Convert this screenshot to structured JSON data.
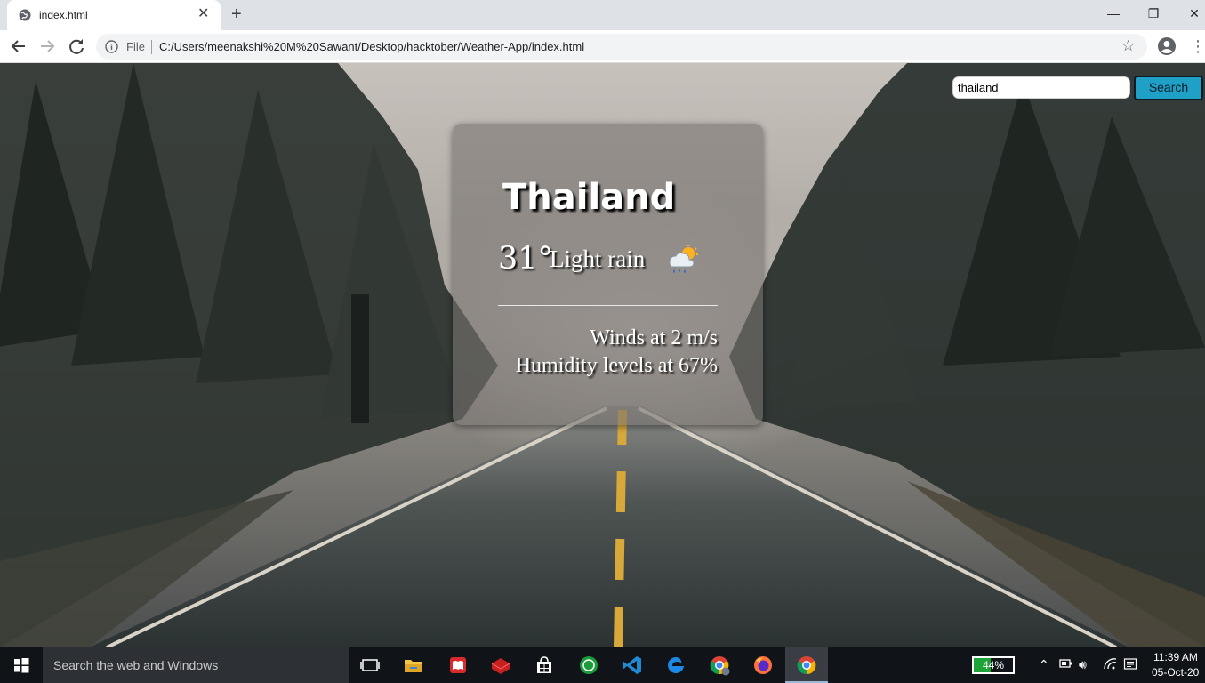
{
  "browser": {
    "tab_title": "index.html",
    "tab_close_glyph": "✕",
    "new_tab_glyph": "+",
    "window_controls": {
      "minimize": "—",
      "restore": "❐",
      "close": "✕"
    },
    "address_scheme_label": "File",
    "address_url": "C:/Users/meenakshi%20M%20Sawant/Desktop/hacktober/Weather-App/index.html",
    "icons": [
      "back-icon",
      "forward-icon",
      "reload-icon",
      "info-icon",
      "bookmark-star-icon",
      "profile-icon",
      "menu-icon"
    ]
  },
  "search": {
    "input_value": "thailand",
    "button_label": "Search"
  },
  "weather": {
    "city": "Thailand",
    "temperature": "31°",
    "description": "Light rain",
    "icon": "light-rain-icon",
    "wind": "Winds at 2 m/s",
    "humidity": "Humidity levels at 67%"
  },
  "taskbar": {
    "search_placeholder": "Search the web and Windows",
    "battery_label": "44%",
    "battery_level": 0.44,
    "time": "11:39 AM",
    "date": "05-Oct-20",
    "apps": [
      "task-view-icon",
      "file-explorer-icon",
      "app-red-book-icon",
      "app-red-box-icon",
      "store-icon",
      "app-green-circle-icon",
      "vscode-icon",
      "edge-icon",
      "chrome-profile-icon",
      "firefox-icon",
      "chrome-icon"
    ]
  },
  "colors": {
    "search_button": "#1fa1c7",
    "card_background": "rgba(120,115,112,0.6)",
    "battery_fill": "#1ea336",
    "taskbar": "#101418"
  }
}
